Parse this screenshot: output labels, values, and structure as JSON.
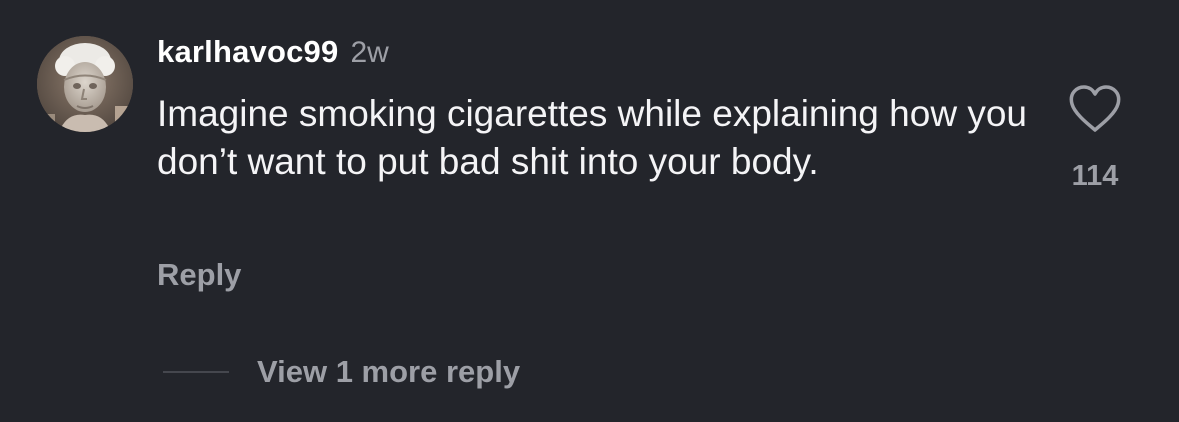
{
  "comment": {
    "username": "karlhavoc99",
    "timestamp": "2w",
    "text": "Imagine smoking cigarettes while explaining how you don’t want to put bad shit into your body.",
    "reply_label": "Reply",
    "like_count": "114",
    "view_replies_label": "View 1 more reply",
    "avatar_icon": "profile-avatar-image",
    "like_icon": "heart-outline-icon"
  },
  "colors": {
    "background": "#23252b",
    "primary_text": "#f4f4f6",
    "secondary_text": "#9d9fa6",
    "divider": "#45474e"
  }
}
